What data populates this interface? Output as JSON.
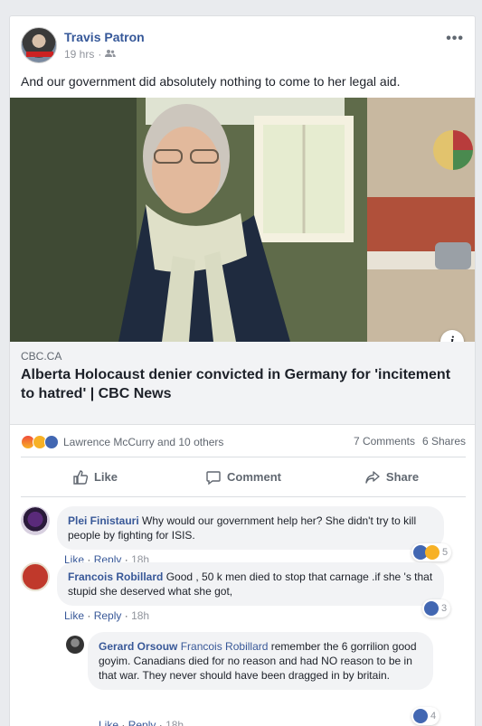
{
  "post": {
    "author": "Travis Patron",
    "time": "19 hrs",
    "audience_icon": "friends-icon",
    "text": "And our government did absolutely nothing to come to her legal aid.",
    "more_icon": "•••"
  },
  "link": {
    "domain": "CBC.CA",
    "title": "Alberta Holocaust denier convicted in Germany for 'incitement to hatred' | CBC News",
    "info_icon": "i"
  },
  "stats": {
    "reaction_icons": [
      "angry-icon",
      "wow-icon",
      "like-icon"
    ],
    "reactors": "Lawrence McCurry and 10 others",
    "comments": "7 Comments",
    "shares": "6 Shares"
  },
  "actions": {
    "like": "Like",
    "comment": "Comment",
    "share": "Share"
  },
  "comments": [
    {
      "name": "Plei Finistauri",
      "text": "Why would our government help her? She didn't try to kill people by fighting for ISIS.",
      "like": "Like",
      "reply": "Reply",
      "time": "18h",
      "reactions": "5"
    },
    {
      "name": "Francois Robillard",
      "text": "Good , 50 k men died to stop that carnage .if she 's that stupid she deserved what she got,",
      "like": "Like",
      "reply": "Reply",
      "time": "18h",
      "reactions": "3"
    },
    {
      "name": "Gerard Orsouw",
      "tag": "Francois Robillard",
      "text": "remember the 6 gorrilion good goyim. Canadians died for no reason and had NO reason to be in that war. They never should have been dragged in by britain.",
      "like": "Like",
      "reply": "Reply",
      "time": "18h",
      "reactions": "4"
    }
  ],
  "separator": "·"
}
